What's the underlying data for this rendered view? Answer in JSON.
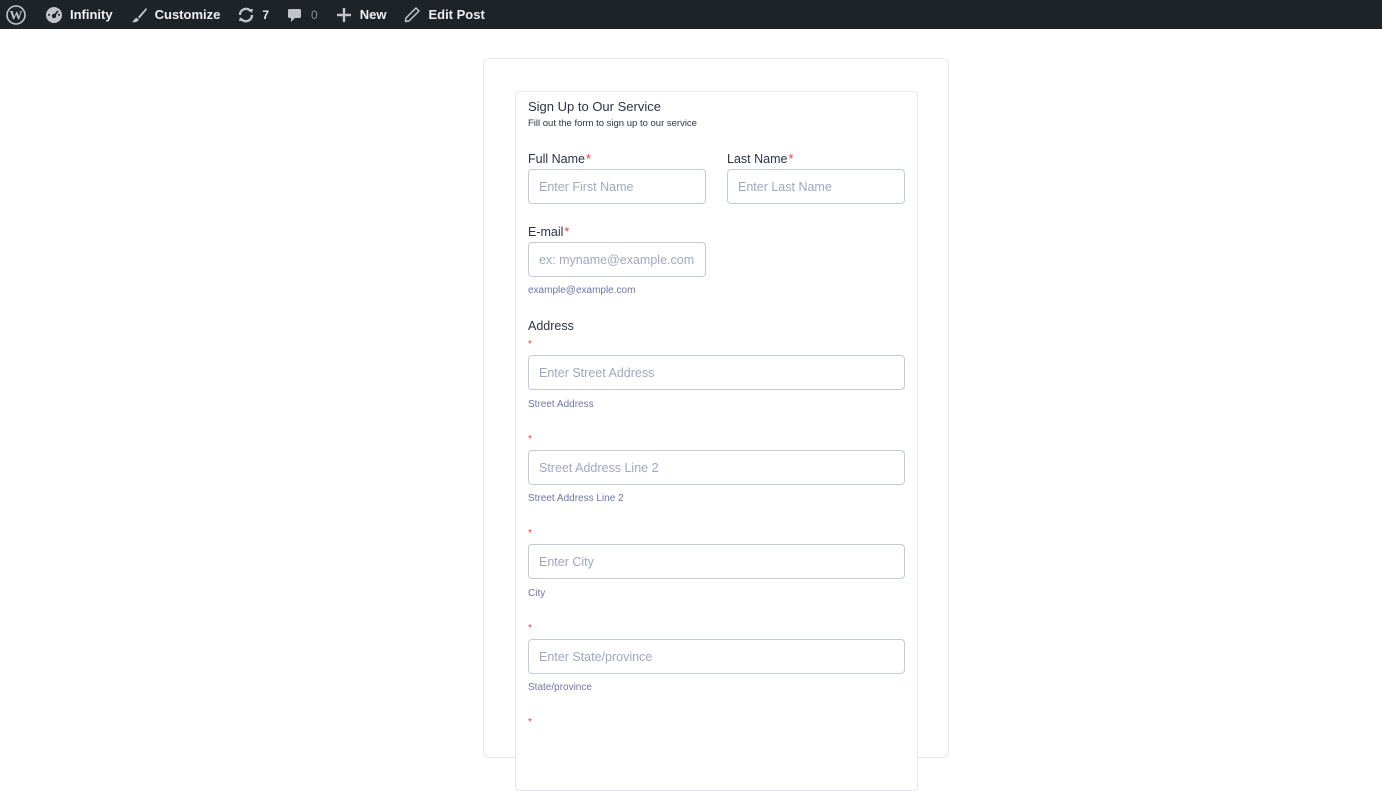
{
  "adminbar": {
    "site_name": "Infinity",
    "customize": "Customize",
    "updates_count": "7",
    "comments_count": "0",
    "new_label": "New",
    "edit_post": "Edit Post"
  },
  "form": {
    "title": "Sign Up to Our Service",
    "subtitle": "Fill out the form to sign up to our service",
    "first_name": {
      "label": "Full Name",
      "placeholder": "Enter First Name"
    },
    "last_name": {
      "label": "Last Name",
      "placeholder": "Enter Last Name"
    },
    "email": {
      "label": "E-mail",
      "placeholder": "ex: myname@example.com",
      "sublabel": "example@example.com"
    },
    "address": {
      "label": "Address",
      "street": {
        "placeholder": "Enter Street Address",
        "sublabel": "Street Address"
      },
      "street2": {
        "placeholder": "Street Address Line 2",
        "sublabel": "Street Address Line 2"
      },
      "city": {
        "placeholder": "Enter City",
        "sublabel": "City"
      },
      "state": {
        "placeholder": "Enter State/province",
        "sublabel": "State/province"
      }
    },
    "required_mark": "*"
  },
  "colors": {
    "adminbar_bg": "#1d2327",
    "required": "#f23a3c",
    "text": "#2c3345",
    "sublabel": "#6f76a7"
  }
}
